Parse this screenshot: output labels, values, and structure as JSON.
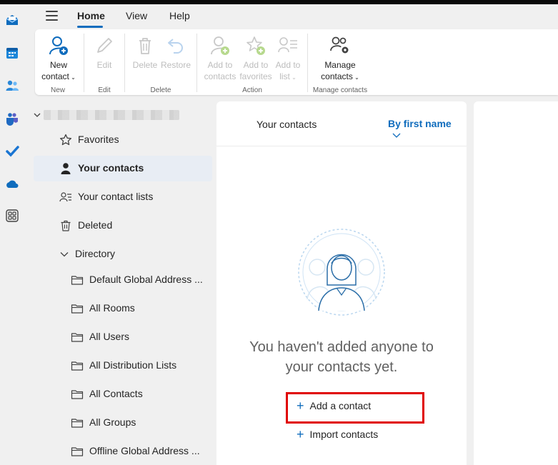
{
  "menu": {
    "tabs": [
      {
        "label": "Home",
        "active": true
      },
      {
        "label": "View",
        "active": false
      },
      {
        "label": "Help",
        "active": false
      }
    ]
  },
  "rail": {
    "icons": [
      "mail-icon",
      "calendar-icon",
      "people-icon",
      "teams-icon",
      "todo-icon",
      "onedrive-icon",
      "apps-icon"
    ]
  },
  "ribbon": {
    "new_contact": {
      "line1": "New",
      "line2": "contact"
    },
    "edit": "Edit",
    "delete": "Delete",
    "restore": "Restore",
    "add_to_contacts": {
      "line1": "Add to",
      "line2": "contacts"
    },
    "add_to_favorites": {
      "line1": "Add to",
      "line2": "favorites"
    },
    "add_to_list": {
      "line1": "Add to",
      "line2": "list"
    },
    "manage_contacts": {
      "line1": "Manage",
      "line2": "contacts"
    },
    "groups": {
      "new": "New",
      "edit": "Edit",
      "delete": "Delete",
      "action": "Action",
      "manage": "Manage contacts"
    }
  },
  "folders": {
    "account": "",
    "items": [
      {
        "label": "Favorites",
        "icon": "star-icon"
      },
      {
        "label": "Your contacts",
        "icon": "person-icon",
        "selected": true
      },
      {
        "label": "Your contact lists",
        "icon": "contact-list-icon"
      },
      {
        "label": "Deleted",
        "icon": "trash-icon"
      },
      {
        "label": "Directory",
        "icon": "chevron-down-icon"
      },
      {
        "label": "Default Global Address ...",
        "icon": "folder-icon"
      },
      {
        "label": "All Rooms",
        "icon": "folder-icon"
      },
      {
        "label": "All Users",
        "icon": "folder-icon"
      },
      {
        "label": "All Distribution Lists",
        "icon": "folder-icon"
      },
      {
        "label": "All Contacts",
        "icon": "folder-icon"
      },
      {
        "label": "All Groups",
        "icon": "folder-icon"
      },
      {
        "label": "Offline Global Address ...",
        "icon": "folder-icon"
      }
    ]
  },
  "list": {
    "title": "Your contacts",
    "sort_label": "By first name",
    "empty_line1": "You haven't added anyone to",
    "empty_line2": "your contacts yet.",
    "add_contact": "Add a contact",
    "import_contacts": "Import contacts"
  },
  "colors": {
    "accent": "#0f6cbd",
    "highlight": "#e00000",
    "disabled": "#bdbdbd",
    "add_badge": "#6bb700"
  }
}
